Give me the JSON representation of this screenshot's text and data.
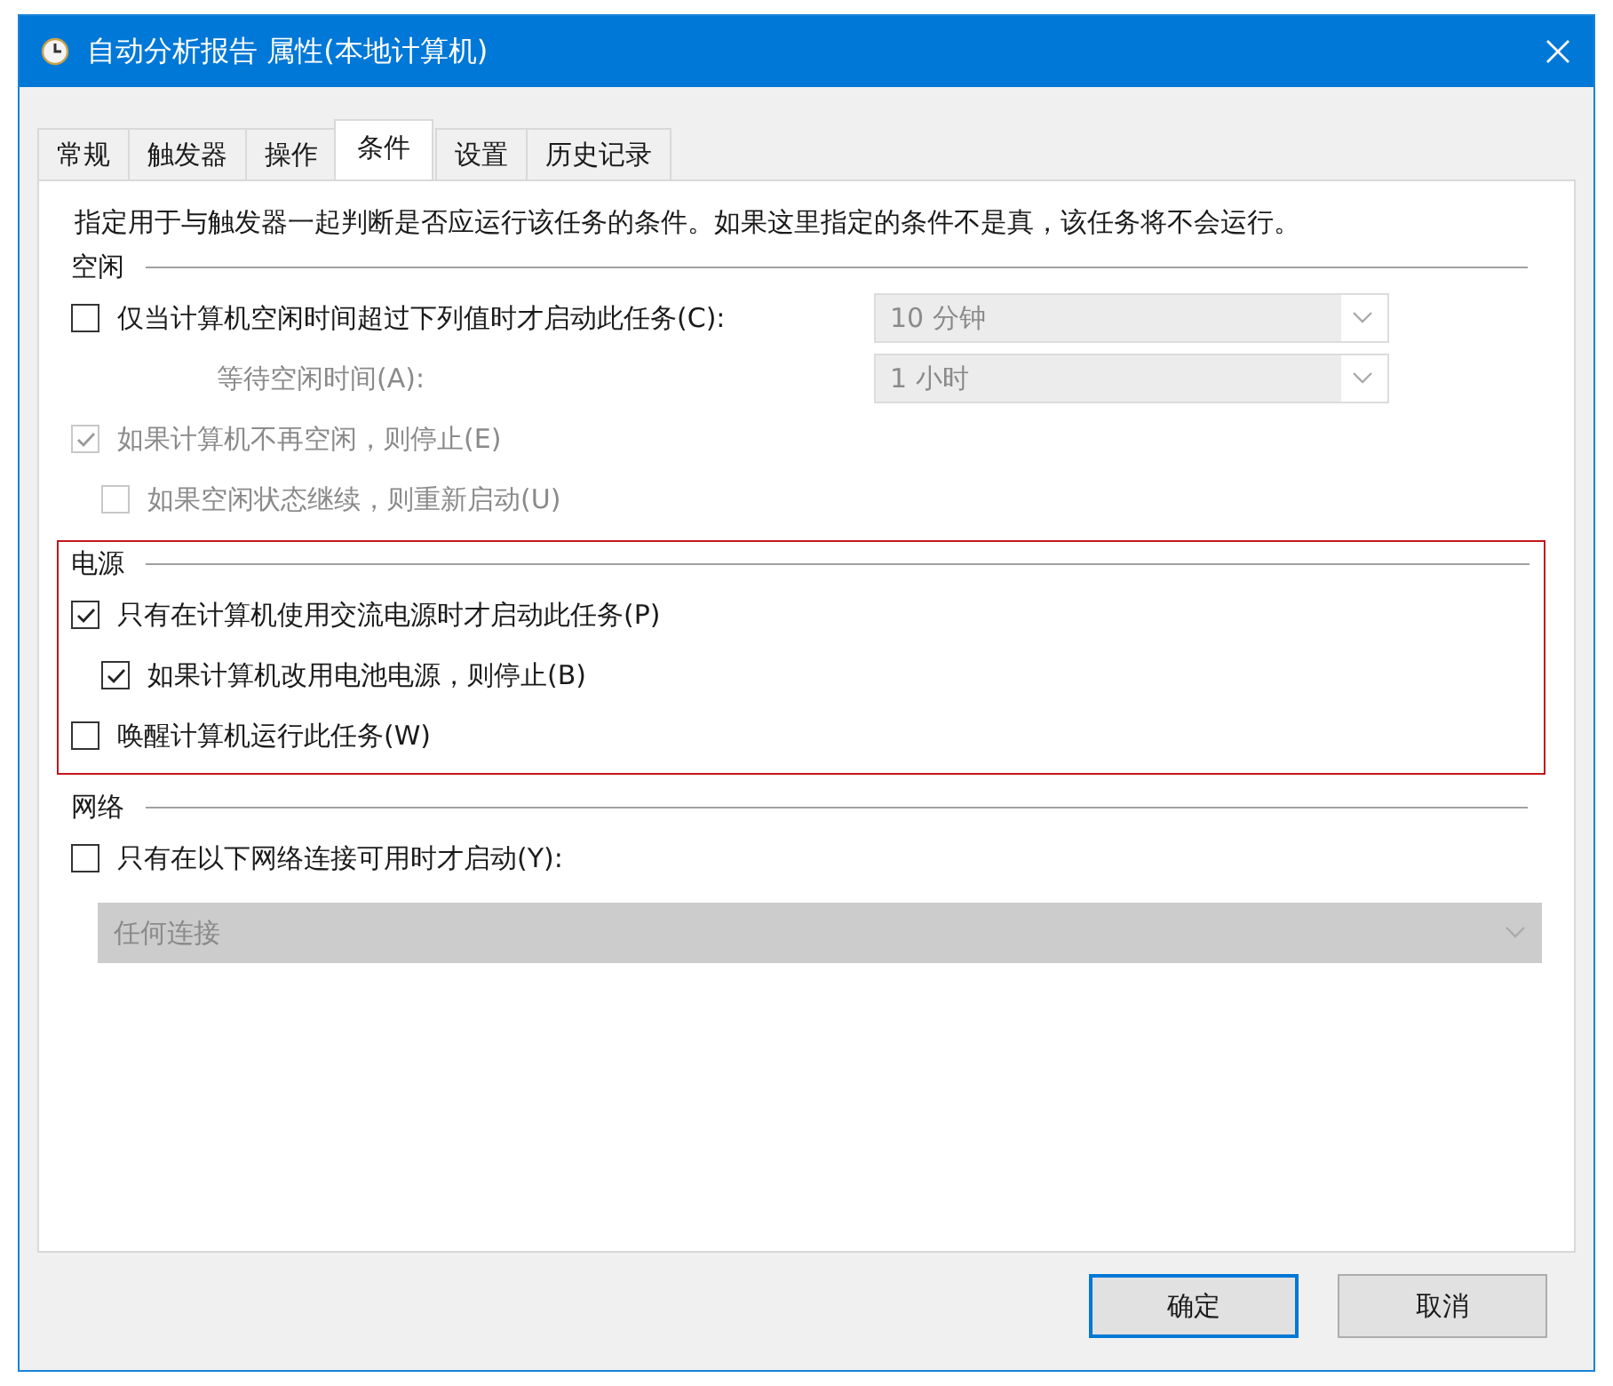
{
  "window": {
    "title": "自动分析报告 属性(本地计算机)"
  },
  "tabs": [
    {
      "label": "常规",
      "selected": false
    },
    {
      "label": "触发器",
      "selected": false
    },
    {
      "label": "操作",
      "selected": false
    },
    {
      "label": "条件",
      "selected": true
    },
    {
      "label": "设置",
      "selected": false
    },
    {
      "label": "历史记录",
      "selected": false
    }
  ],
  "description": "指定用于与触发器一起判断是否应运行该任务的条件。如果这里指定的条件不是真，该任务将不会运行。",
  "sections": [
    {
      "title": "空闲",
      "highlighted": false,
      "rows": [
        {
          "kind": "checkbox",
          "label": "仅当计算机空闲时间超过下列值时才启动此任务(C):",
          "checked": false,
          "disabled": false,
          "combo": {
            "value": "10 分钟",
            "disabled": true
          }
        },
        {
          "kind": "label-combo",
          "label": "等待空闲时间(A):",
          "disabled": true,
          "combo": {
            "value": "1 小时",
            "disabled": true
          }
        },
        {
          "kind": "checkbox",
          "label": "如果计算机不再空闲，则停止(E)",
          "checked": true,
          "disabled": true,
          "children": [
            {
              "kind": "checkbox",
              "label": "如果空闲状态继续，则重新启动(U)",
              "checked": false,
              "disabled": true
            }
          ]
        }
      ]
    },
    {
      "title": "电源",
      "highlighted": true,
      "rows": [
        {
          "kind": "checkbox",
          "label": "只有在计算机使用交流电源时才启动此任务(P)",
          "checked": true,
          "disabled": false,
          "children": [
            {
              "kind": "checkbox",
              "label": "如果计算机改用电池电源，则停止(B)",
              "checked": true,
              "disabled": false
            }
          ]
        },
        {
          "kind": "checkbox",
          "label": "唤醒计算机运行此任务(W)",
          "checked": false,
          "disabled": false
        }
      ]
    },
    {
      "title": "网络",
      "highlighted": false,
      "rows": [
        {
          "kind": "checkbox",
          "label": "只有在以下网络连接可用时才启动(Y):",
          "checked": false,
          "disabled": false
        },
        {
          "kind": "wide-combo",
          "combo": {
            "value": "任何连接",
            "disabled": true
          }
        }
      ]
    }
  ],
  "buttons": [
    {
      "label": "确定",
      "default": true
    },
    {
      "label": "取消",
      "default": false
    }
  ]
}
